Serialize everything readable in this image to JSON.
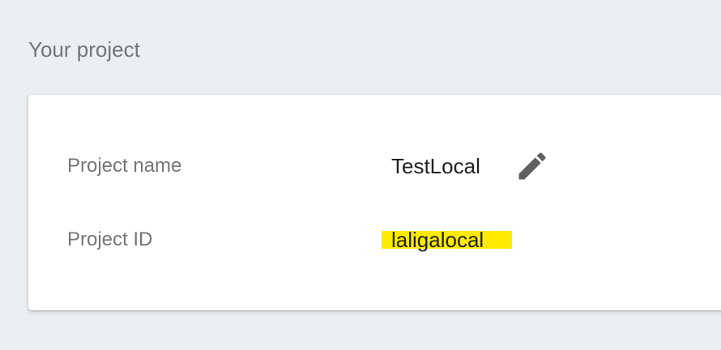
{
  "section": {
    "title": "Your project"
  },
  "project": {
    "name_label": "Project name",
    "name_value": "TestLocal",
    "id_label": "Project ID",
    "id_value": "laligalocal"
  },
  "icons": {
    "edit": "pencil-edit-icon"
  },
  "colors": {
    "background": "#eceff1",
    "card": "#ffffff",
    "label_text": "#757575",
    "value_text": "#212121",
    "icon": "#616161",
    "highlight": "#ffeb00"
  }
}
